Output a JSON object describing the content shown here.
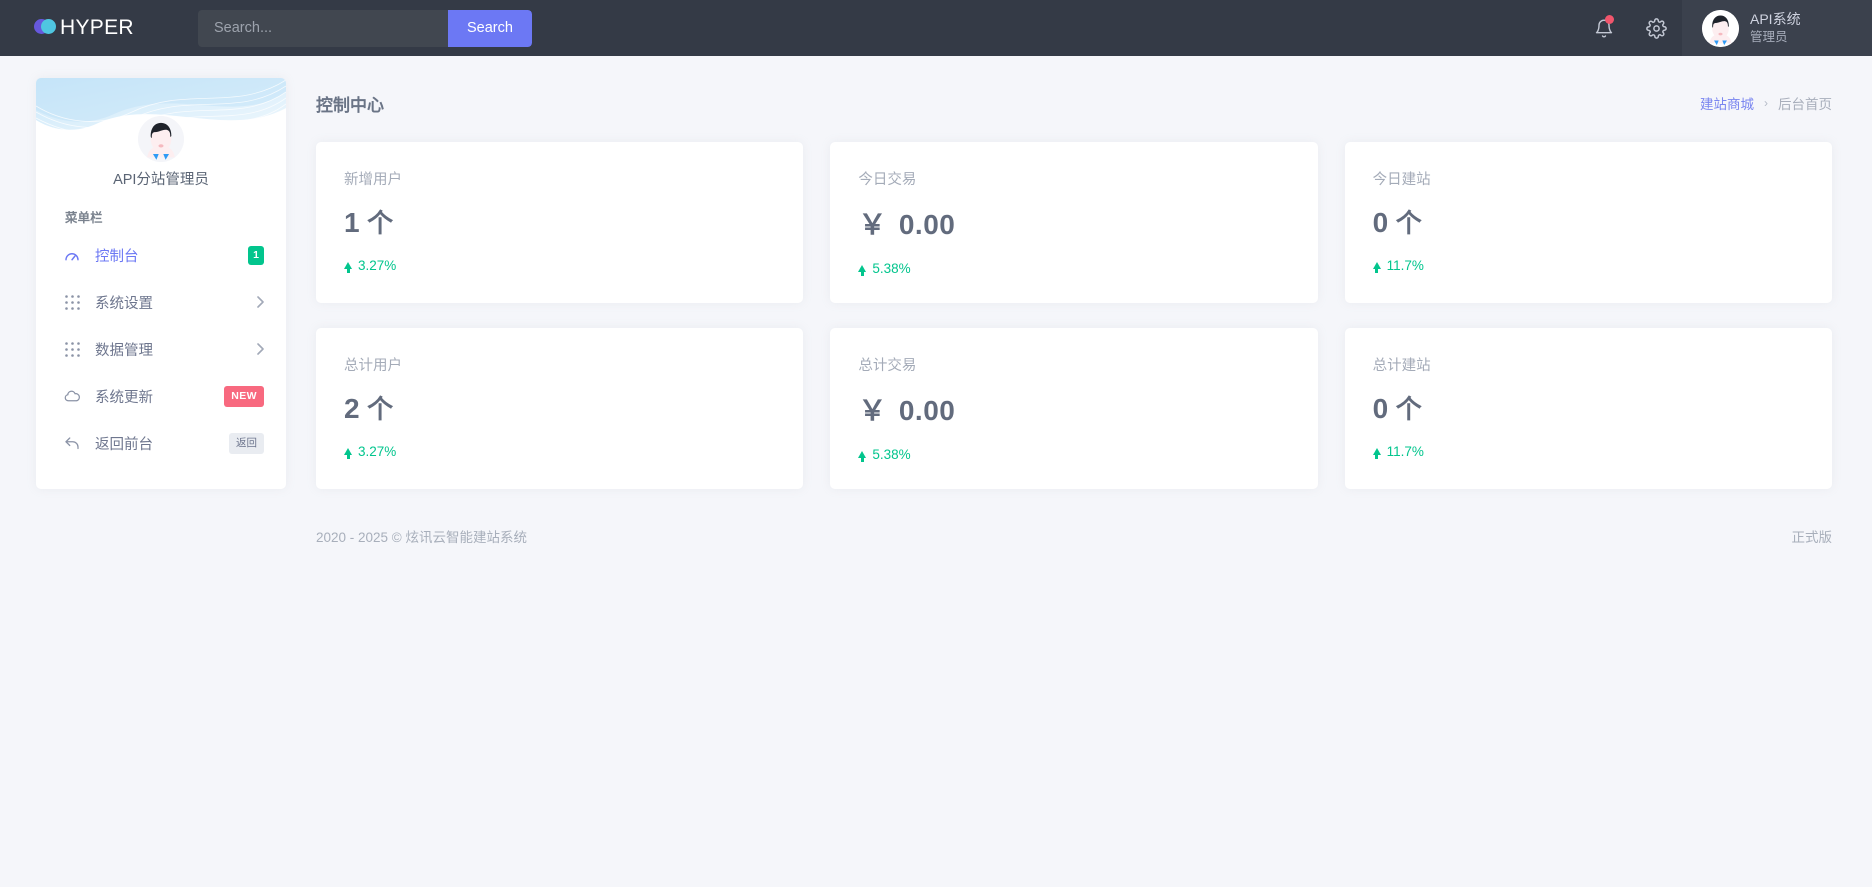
{
  "topbar": {
    "brand": "HYPER",
    "brand_icon": "hyper-logo-icon",
    "search": {
      "placeholder": "Search...",
      "value": "",
      "button_label": "Search"
    },
    "notification_icon": "bell-icon",
    "settings_icon": "gear-icon",
    "user": {
      "name": "API系统",
      "role": "管理员",
      "avatar_icon": "user-avatar"
    }
  },
  "sidebar": {
    "profile_name": "API分站管理员",
    "menu_caption": "菜单栏",
    "items": [
      {
        "label": "控制台",
        "icon": "dashboard-speedometer-icon",
        "badge": "1",
        "badge_style": "green",
        "active": true,
        "chevron": false
      },
      {
        "label": "系统设置",
        "icon": "grid-dots-icon",
        "badge": "",
        "badge_style": "",
        "active": false,
        "chevron": true
      },
      {
        "label": "数据管理",
        "icon": "grid-dots-icon",
        "badge": "",
        "badge_style": "",
        "active": false,
        "chevron": true
      },
      {
        "label": "系统更新",
        "icon": "cloud-icon",
        "badge": "NEW",
        "badge_style": "pink",
        "active": false,
        "chevron": false
      },
      {
        "label": "返回前台",
        "icon": "reply-arrow-icon",
        "badge": "返回",
        "badge_style": "grey",
        "active": false,
        "chevron": false
      }
    ]
  },
  "page": {
    "title": "控制中心",
    "breadcrumb": {
      "link": "建站商城",
      "separator": "›",
      "current": "后台首页"
    }
  },
  "stats": [
    {
      "title": "新增用户",
      "prefix": "",
      "value": "1",
      "unit": "个",
      "delta": "3.27%",
      "trend": "up"
    },
    {
      "title": "今日交易",
      "prefix": "￥",
      "value": "0.00",
      "unit": "",
      "delta": "5.38%",
      "trend": "up"
    },
    {
      "title": "今日建站",
      "prefix": "",
      "value": "0",
      "unit": "个",
      "delta": "11.7%",
      "trend": "up"
    },
    {
      "title": "总计用户",
      "prefix": "",
      "value": "2",
      "unit": "个",
      "delta": "3.27%",
      "trend": "up"
    },
    {
      "title": "总计交易",
      "prefix": "￥",
      "value": "0.00",
      "unit": "",
      "delta": "5.38%",
      "trend": "up"
    },
    {
      "title": "总计建站",
      "prefix": "",
      "value": "0",
      "unit": "个",
      "delta": "11.7%",
      "trend": "up"
    }
  ],
  "footer": {
    "copyright": "2020 - 2025 © 炫讯云智能建站系统",
    "edition": "正式版"
  },
  "colors": {
    "topbar_bg": "#343a46",
    "accent": "#6c78f4",
    "success": "#02c58d",
    "danger": "#f1556c",
    "badge_pink": "#f8697f",
    "page_bg": "#f5f6fa"
  }
}
